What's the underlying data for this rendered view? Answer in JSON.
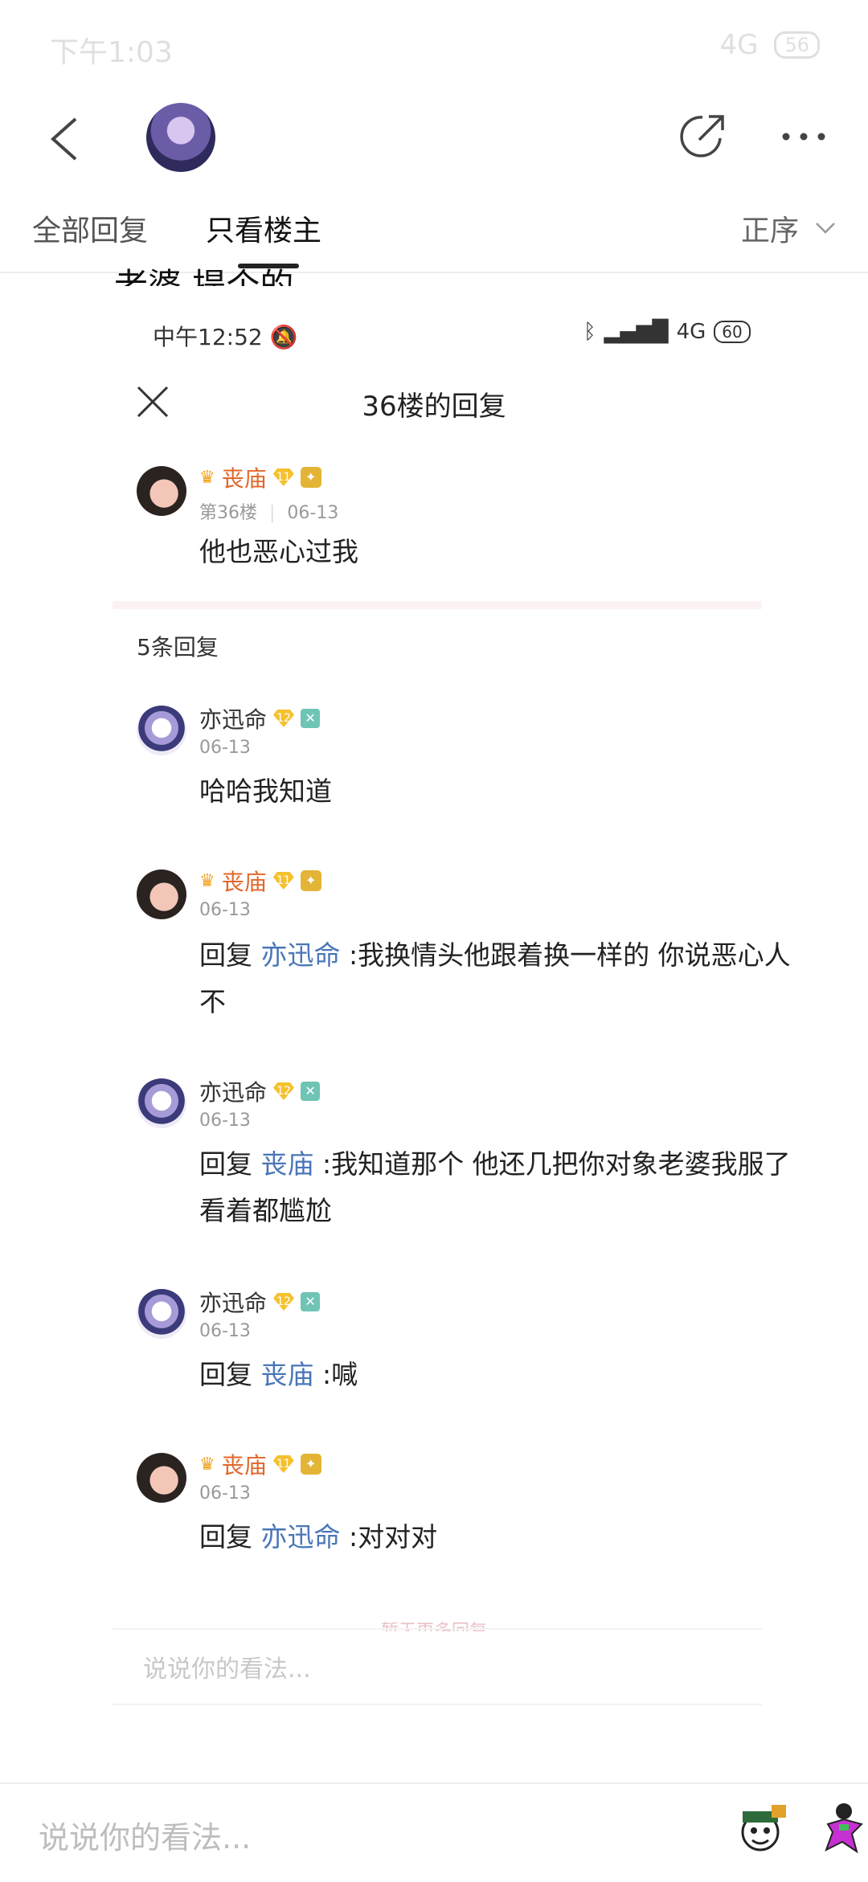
{
  "status_bar": {
    "time": "下午1:03",
    "network": "4G",
    "battery": "56"
  },
  "header": {
    "back_icon": "chevron-left-icon",
    "share_icon": "share-icon",
    "more_icon": "more-horizontal-icon"
  },
  "tabs": {
    "all_replies": "全部回复",
    "op_only": "只看楼主",
    "sort": "正序"
  },
  "clipped_text": "老婆 提个的",
  "inner_status": {
    "time": "中午12:52",
    "network": "4G",
    "battery": "60"
  },
  "sheet": {
    "title": "36楼的回复",
    "op": {
      "username": "丧庙",
      "level": "11",
      "floor": "第36楼",
      "date": "06-13",
      "content": "他也恶心过我"
    },
    "reply_count": "5条回复",
    "replies": [
      {
        "username": "亦迅命",
        "level": "12",
        "date": "06-13",
        "prefix": "",
        "target": "",
        "content": "哈哈我知道"
      },
      {
        "username": "丧庙",
        "level": "11",
        "date": "06-13",
        "prefix": "回复 ",
        "target": "亦迅命",
        "content": " :我换情头他跟着换一样的 你说恶心人不"
      },
      {
        "username": "亦迅命",
        "level": "12",
        "date": "06-13",
        "prefix": "回复 ",
        "target": "丧庙",
        "content": " :我知道那个 他还几把你对象老婆我服了 看着都尴尬"
      },
      {
        "username": "亦迅命",
        "level": "12",
        "date": "06-13",
        "prefix": "回复 ",
        "target": "丧庙",
        "content": " :喊"
      },
      {
        "username": "丧庙",
        "level": "11",
        "date": "06-13",
        "prefix": "回复 ",
        "target": "亦迅命",
        "content": " :对对对"
      }
    ],
    "more_replies": "暂无更多回复",
    "input_placeholder": "说说你的看法..."
  },
  "bottom": {
    "input_placeholder": "说说你的看法..."
  },
  "colors": {
    "host_name": "#e2672a",
    "link": "#4a76b8",
    "gold_badge": "#f5c12e"
  }
}
